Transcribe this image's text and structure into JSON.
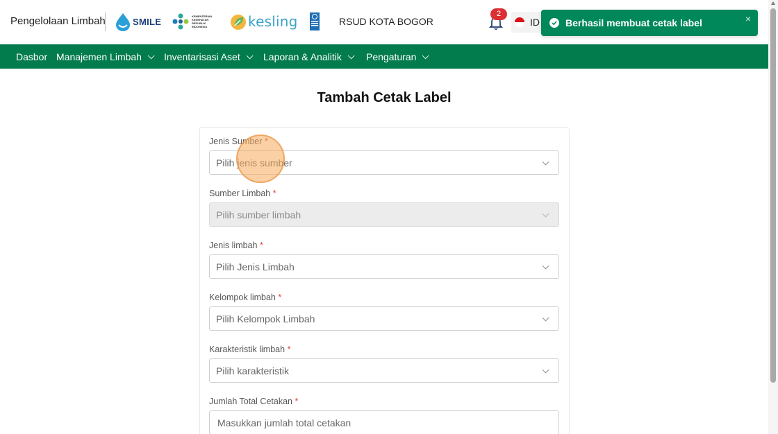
{
  "header": {
    "app_name": "Pengelolaan Limbah",
    "logos": {
      "smile": "SMILE",
      "kemenkes": "KEMENTERIAN KESEHATAN REPUBLIK INDONESIA",
      "kesling": "kesling",
      "undp": "UNDP"
    },
    "hospital": "RSUD KOTA BOGOR",
    "notification_count": "2",
    "language_code": "ID"
  },
  "toast": {
    "message": "Berhasil membuat cetak label",
    "close_symbol": "×"
  },
  "nav": {
    "items": [
      {
        "label": "Dasbor",
        "has_dropdown": false
      },
      {
        "label": "Manajemen Limbah",
        "has_dropdown": true
      },
      {
        "label": "Inventarisasi Aset",
        "has_dropdown": true
      },
      {
        "label": "Laporan & Analitik",
        "has_dropdown": true
      },
      {
        "label": "Pengaturan",
        "has_dropdown": true
      }
    ]
  },
  "page": {
    "title": "Tambah Cetak Label"
  },
  "form": {
    "required_mark": "*",
    "jenis_sumber": {
      "label": "Jenis Sumber",
      "placeholder": "Pilih jenis sumber"
    },
    "sumber_limbah": {
      "label": "Sumber Limbah",
      "placeholder": "Pilih sumber limbah",
      "disabled": true
    },
    "jenis_limbah": {
      "label": "Jenis limbah",
      "placeholder": "Pilih Jenis Limbah"
    },
    "kelompok_limbah": {
      "label": "Kelompok limbah",
      "placeholder": "Pilih Kelompok Limbah"
    },
    "karakteristik_limbah": {
      "label": "Karakteristik limbah",
      "placeholder": "Pilih karakteristik"
    },
    "jumlah_total_cetakan": {
      "label": "Jumlah Total Cetakan",
      "placeholder": "Masukkan jumlah total cetakan"
    }
  },
  "colors": {
    "nav_bg": "#027b4d",
    "toast_bg": "#00875a",
    "badge_bg": "#dc2f34",
    "required": "#e0403f"
  }
}
